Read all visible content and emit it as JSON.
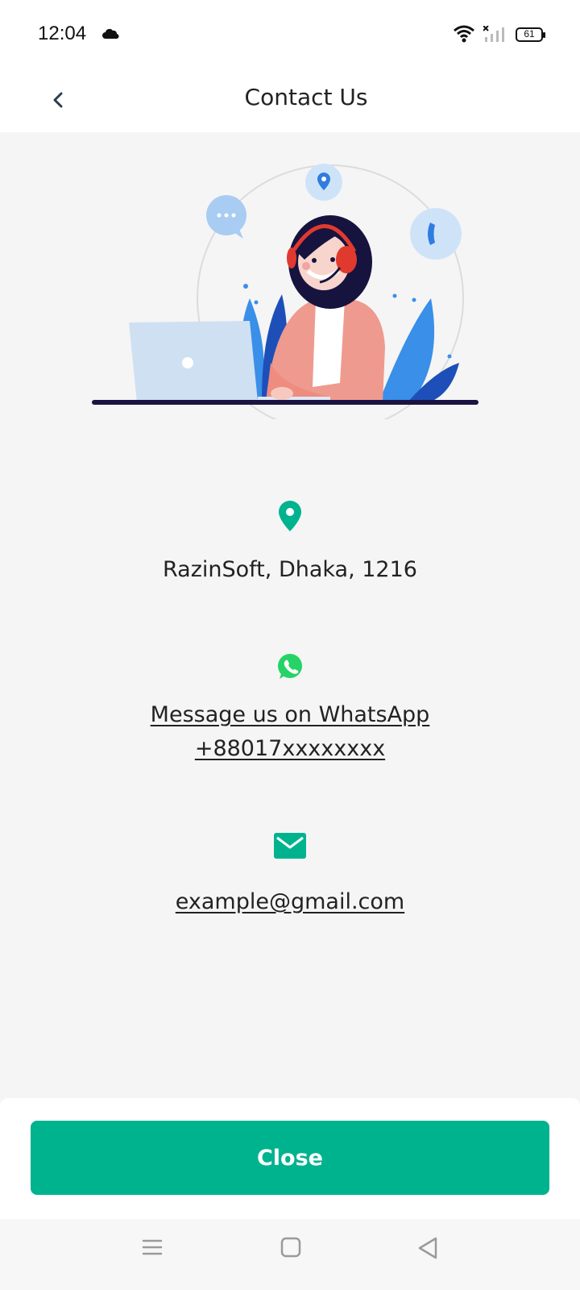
{
  "status_bar": {
    "time": "12:04",
    "battery": "61",
    "icons": [
      "cloud-icon",
      "wifi-icon",
      "signal-icon",
      "battery-icon"
    ]
  },
  "header": {
    "title": "Contact Us",
    "back_icon": "chevron-left-icon"
  },
  "contacts": {
    "address": {
      "icon": "location-pin-icon",
      "text": "RazinSoft, Dhaka, 1216"
    },
    "whatsapp": {
      "icon": "whatsapp-icon",
      "line1": "Message us on WhatsApp",
      "line2": "+88017xxxxxxxx"
    },
    "email": {
      "icon": "mail-icon",
      "text": "example@gmail.com"
    }
  },
  "footer": {
    "close_label": "Close"
  },
  "nav": {
    "icons": [
      "menu-icon",
      "home-icon",
      "back-icon"
    ]
  },
  "colors": {
    "accent": "#00b38f",
    "whatsapp": "#25d366",
    "header_icon": "#2c3e50"
  }
}
